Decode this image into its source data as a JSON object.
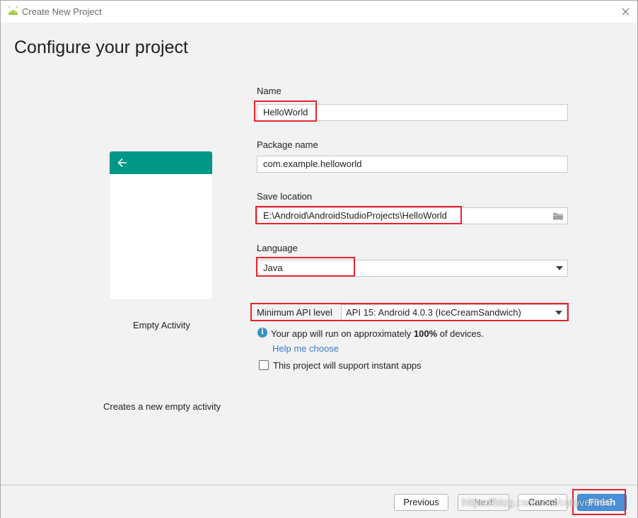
{
  "window": {
    "title": "Create New Project"
  },
  "header": {
    "title": "Configure your project"
  },
  "template": {
    "name": "Empty Activity",
    "description": "Creates a new empty activity"
  },
  "form": {
    "name_label": "Name",
    "name_value": "HelloWorld",
    "package_label": "Package name",
    "package_value": "com.example.helloworld",
    "location_label": "Save location",
    "location_value": "E:\\Android\\AndroidStudioProjects\\HelloWorld",
    "language_label": "Language",
    "language_value": "Java",
    "api_label": "Minimum API level",
    "api_value": "API 15: Android 4.0.3 (IceCreamSandwich)",
    "info_prefix": "Your app will run on approximately ",
    "info_percent": "100%",
    "info_suffix": " of devices.",
    "help_link": "Help me choose",
    "instant_apps_label": "This project will support instant apps",
    "instant_apps_checked": false
  },
  "footer": {
    "previous": "Previous",
    "next": "Next",
    "cancel": "Cancel",
    "finish": "Finish"
  },
  "watermark": "https://blog.csdn.net/culover666",
  "colors": {
    "accent": "#009688",
    "highlight": "#e8232d",
    "link": "#3d7cc9",
    "primary_button": "#4a90d9"
  }
}
